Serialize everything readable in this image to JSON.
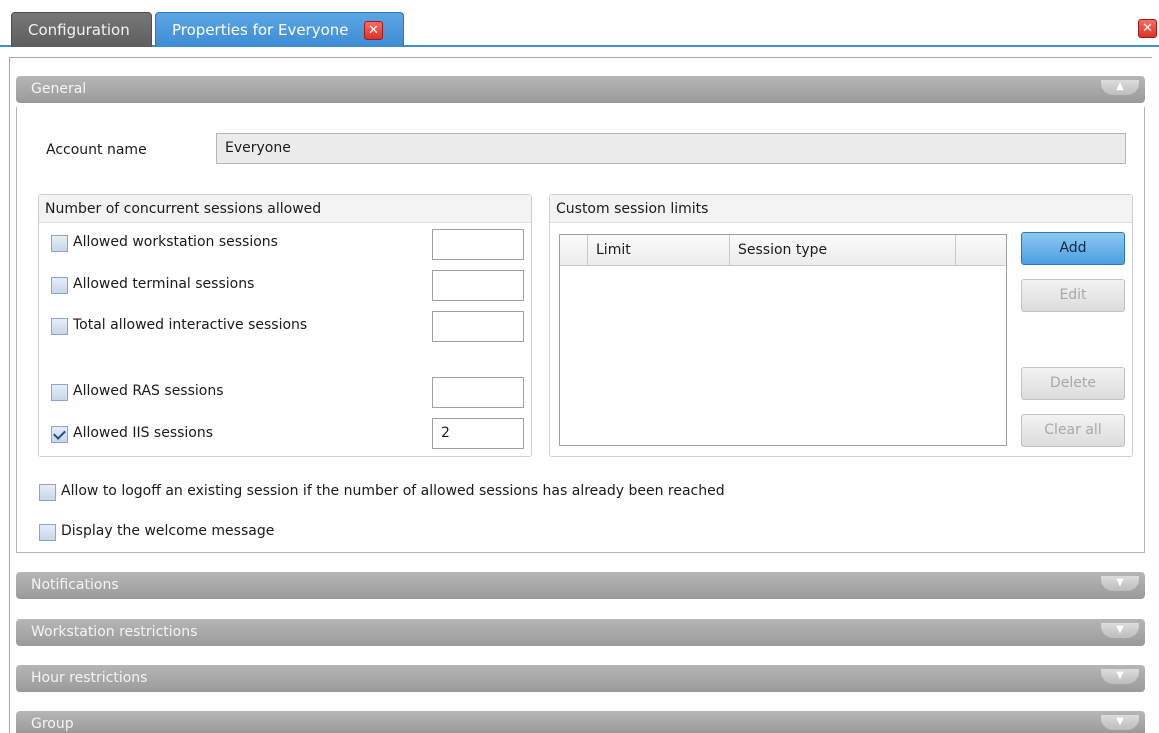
{
  "tabs": [
    {
      "label": "Configuration",
      "active": false
    },
    {
      "label": "Properties for Everyone",
      "active": true
    }
  ],
  "icons": {
    "tab_close": "close-icon",
    "window_close": "close-icon",
    "section_toggle": "chevron-icon"
  },
  "colors": {
    "accent": "#3d8cd2",
    "close": "#d8332a",
    "section": "#a8a8a8"
  },
  "sections": {
    "general": {
      "title": "General",
      "expanded": true
    },
    "notifications": {
      "title": "Notifications"
    },
    "workstation": {
      "title": "Workstation restrictions"
    },
    "hours": {
      "title": "Hour restrictions"
    },
    "group": {
      "title": "Group"
    }
  },
  "account": {
    "label": "Account name",
    "value": "Everyone"
  },
  "concurrent": {
    "title": "Number of concurrent sessions allowed",
    "items": [
      {
        "label": "Allowed workstation sessions",
        "checked": false,
        "value": ""
      },
      {
        "label": "Allowed terminal sessions",
        "checked": false,
        "value": ""
      },
      {
        "label": "Total allowed interactive sessions",
        "checked": false,
        "value": ""
      },
      {
        "label": "Allowed RAS sessions",
        "checked": false,
        "value": ""
      },
      {
        "label": "Allowed IIS sessions",
        "checked": true,
        "value": "2"
      }
    ]
  },
  "custom": {
    "title": "Custom session limits",
    "columns": [
      "Limit",
      "Session type"
    ],
    "rows": [],
    "buttons": {
      "add": "Add",
      "edit": "Edit",
      "delete": "Delete",
      "clear": "Clear all"
    }
  },
  "options": {
    "logoff": {
      "label": "Allow to logoff an existing session if the number of allowed sessions has already been reached",
      "checked": false
    },
    "welcome": {
      "label": "Display the welcome message",
      "checked": false
    }
  }
}
